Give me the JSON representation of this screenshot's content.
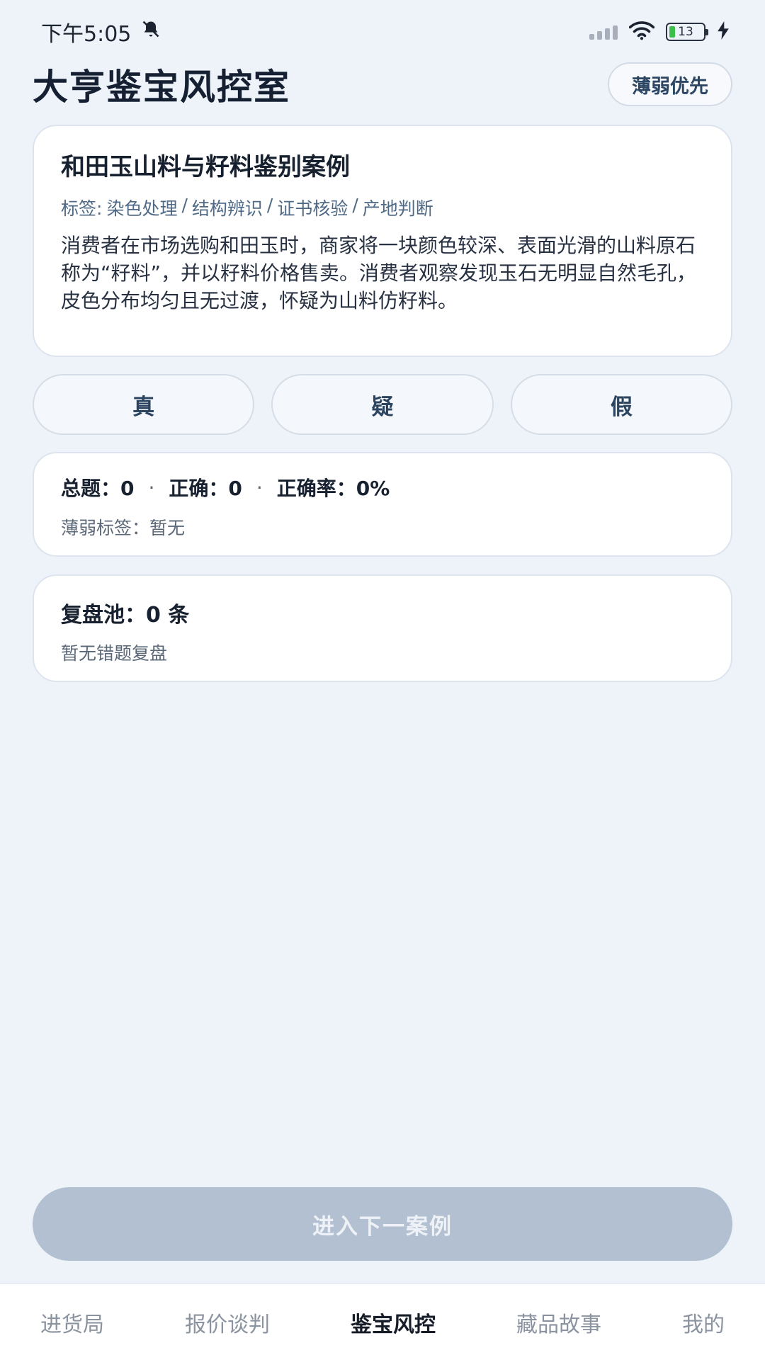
{
  "status_bar": {
    "time": "下午5:05",
    "battery": "13",
    "icons": [
      "bell-muted-icon",
      "signal-icon",
      "wifi-icon",
      "battery-icon",
      "charging-icon"
    ]
  },
  "header": {
    "title": "大亨鉴宝风控室",
    "weak_first_label": "薄弱优先"
  },
  "case": {
    "title": "和田玉山料与籽料鉴别案例",
    "tags_prefix": "标签:",
    "tags": [
      "染色处理",
      "/",
      "结构辨识",
      "/",
      "证书核验",
      "/",
      "产地判断"
    ],
    "description": "消费者在市场选购和田玉时，商家将一块颜色较深、表面光滑的山料原石称为“籽料”，并以籽料价格售卖。消费者观察发现玉石无明显自然毛孔，皮色分布均匀且无过渡，怀疑为山料仿籽料。"
  },
  "answers": {
    "real": "真",
    "doubt": "疑",
    "fake": "假"
  },
  "stats": {
    "total": "总题：0",
    "correct": "正确：0",
    "rate": "正确率：0%",
    "separator": "·",
    "weak_tags": "薄弱标签：暂无"
  },
  "review": {
    "title": "复盘池：0 条",
    "empty": "暂无错题复盘"
  },
  "next_button": "进入下一案例",
  "nav": {
    "items": [
      "进货局",
      "报价谈判",
      "鉴宝风控",
      "藏品故事",
      "我的"
    ],
    "active_index": 2
  },
  "colors": {
    "background": "#eef3fa",
    "accent": "#2c4664",
    "next_disabled": "#b3c0d1"
  }
}
